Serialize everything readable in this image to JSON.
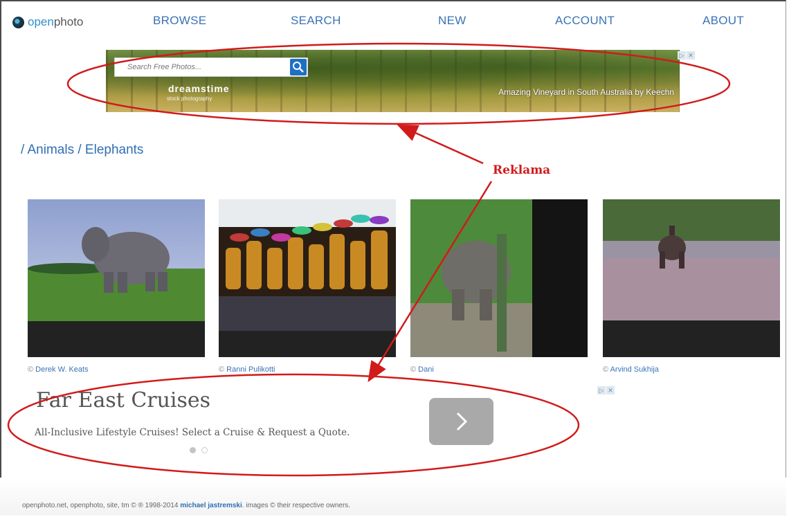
{
  "nav": {
    "logo_prefix": "open",
    "logo_suffix": "photo",
    "links": [
      "BROWSE",
      "SEARCH",
      "NEW",
      "ACCOUNT",
      "ABOUT"
    ]
  },
  "top_ad": {
    "search_placeholder": "Search Free Photos...",
    "brand": "dreamstime",
    "brand_sub": "stock photography",
    "caption": "Amazing Vineyard in South Australia by Keechn"
  },
  "breadcrumb": "/ Animals / Elephants",
  "photos": [
    {
      "credit_prefix": "© ",
      "author": "Derek W. Keats"
    },
    {
      "credit_prefix": "© ",
      "author": "Ranni Pulikotti"
    },
    {
      "credit_prefix": "© ",
      "author": "Dani"
    },
    {
      "credit_prefix": "© ",
      "author": "Arvind Sukhija"
    }
  ],
  "bottom_ad": {
    "title": "Far East Cruises",
    "description": "All-Inclusive Lifestyle Cruises! Select a Cruise & Request a Quote.",
    "arrow_icon": "chevron-right-icon"
  },
  "annotation": {
    "label": "Reklama",
    "color": "#d11a1a"
  },
  "footer": {
    "prefix": "openphoto.net, openphoto, site, tm © ® 1998-2014 ",
    "author": "michael jastremski",
    "suffix": ". images © their respective owners."
  },
  "colors": {
    "link": "#3a72b5",
    "accent": "#2f8fc9"
  }
}
